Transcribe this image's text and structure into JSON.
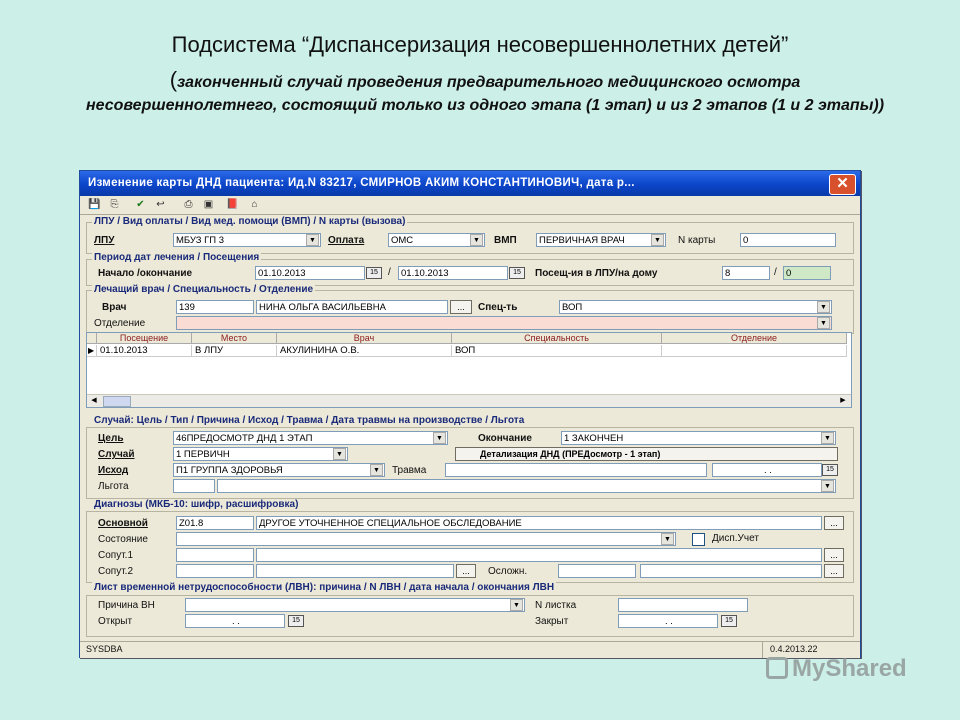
{
  "slide": {
    "title": "Подсистема “Диспансеризация несовершеннолетних детей”",
    "paren_open": "(",
    "subtitle": "законченный случай проведения предварительного медицинского осмотра несовершеннолетнего, состоящий только из одного этапа (1 этап) и из 2 этапов (1 и 2 этапы))"
  },
  "window": {
    "title": "Изменение карты ДНД пациента: Ид.N 83217, СМИРНОВ АКИМ КОНСТАНТИНОВИЧ, дата р...",
    "close_glyph": "✕"
  },
  "toolbar": {
    "icons": [
      "💾",
      "⎘",
      "✔",
      "↩",
      "⎙",
      "▣",
      "📕",
      "⌂"
    ]
  },
  "lpu": {
    "group_label": "ЛПУ / Вид оплаты / Вид мед. помощи (ВМП) / N карты (вызова)",
    "lpu_label": "ЛПУ",
    "lpu_value": "МБУЗ ГП 3",
    "payment_label": "Оплата",
    "payment_value": "ОМС",
    "vmp_label": "ВМП",
    "vmp_value": "ПЕРВИЧНАЯ ВРАЧ",
    "card_label": "N карты",
    "card_value": "0"
  },
  "period": {
    "group_label": "Период дат лечения / Посещения",
    "dates_label": "Начало /окончание",
    "start": "01.10.2013",
    "slash": "/",
    "end": "01.10.2013",
    "visits_label": "Посещ-ия в ЛПУ/на дому",
    "visits_lpu": "8",
    "visits_home": "0"
  },
  "doctor": {
    "group_label": "Лечащий врач / Специальность / Отделение",
    "doctor_label": "Врач",
    "doctor_code": "139",
    "doctor_name": "НИНА ОЛЬГА ВАСИЛЬЕВНА",
    "spec_label": "Спец-ть",
    "spec_value": "ВОП",
    "dept_label": "Отделение",
    "dept_value": ""
  },
  "visits_grid": {
    "columns": [
      "Посещение",
      "Место",
      "Врач",
      "Специальность",
      "Отделение"
    ],
    "rows": [
      [
        "01.10.2013",
        "В ЛПУ",
        "АКУЛИНИНА О.В.",
        "ВОП",
        ""
      ]
    ]
  },
  "case": {
    "group_label": "Случай: Цель / Тип / Причина / Исход / Травма / Дата травмы на производстве / Льгота",
    "goal_label": "Цель",
    "goal_value": "46ПРЕДОСМОТР ДНД 1 ЭТАП",
    "end_label": "Окончание",
    "end_value": "1 ЗАКОНЧЕН",
    "case_label": "Случай",
    "case_value": "1 ПЕРВИЧН",
    "detail_button": "Детализация ДНД (ПРЕДосмотр - 1 этап)",
    "outcome_label": "Исход",
    "outcome_value": "П1 ГРУППА ЗДОРОВЬЯ",
    "trauma_label": "Травма",
    "trauma_date": ".   .",
    "privilege_label": "Льгота"
  },
  "diagnosis": {
    "group_label": "Диагнозы (МКБ-10: шифр, расшифровка)",
    "main_label": "Основной",
    "main_code": "Z01.8",
    "main_text": "ДРУГОЕ УТОЧНЕННОЕ СПЕЦИАЛЬНОЕ ОБСЛЕДОВАНИЕ",
    "state_label": "Состояние",
    "disp_label": "Дисп.Учет",
    "co1_label": "Сопут.1",
    "co2_label": "Сопут.2",
    "compl_label": "Осложн."
  },
  "sick_leave": {
    "group_label": "Лист временной нетрудоспособности (ЛВН): причина / N ЛВН / дата начала / окончания ЛВН",
    "reason_label": "Причина ВН",
    "number_label": "N листка",
    "opened_label": "Открыт",
    "opened_value": ".   .",
    "closed_label": "Закрыт",
    "closed_value": ".   ."
  },
  "status": {
    "user": "SYSDBA",
    "version": "0.4.2013.22"
  },
  "watermark": {
    "text": "MyShared"
  },
  "colors": {
    "titlebar": "#0b45c9",
    "window_bg": "#ece9d8",
    "slide_bg": "#ccefe8",
    "pink_field": "#fadcd4",
    "green_field": "#cfe9c7"
  }
}
